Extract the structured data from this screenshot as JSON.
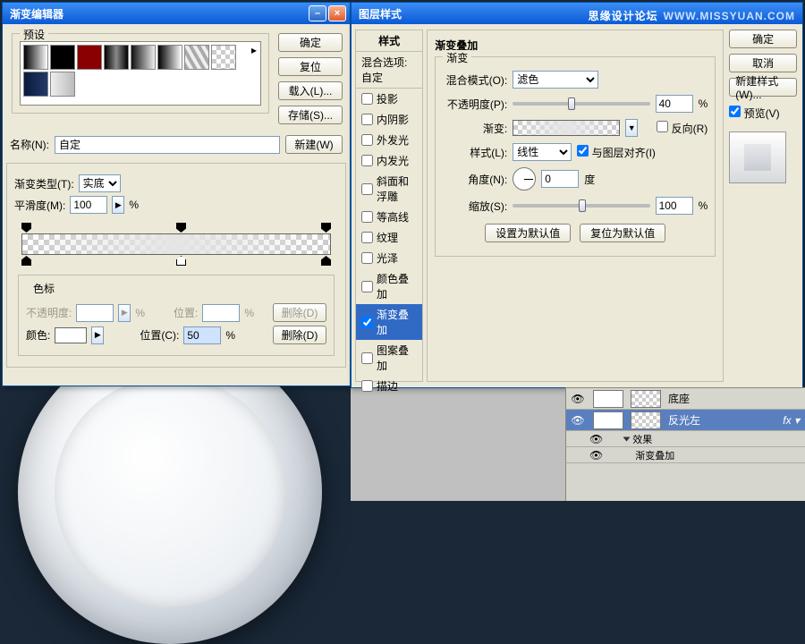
{
  "watermark": {
    "site": "思缘设计论坛",
    "url": "WWW.MISSYUAN.COM"
  },
  "ge": {
    "title": "渐变编辑器",
    "presets_label": "预设",
    "swatches": [
      "linear-gradient(90deg,#000,#fff)",
      "#000",
      "#8a0000",
      "linear-gradient(90deg,#000,#888,#000)",
      "linear-gradient(90deg,#111,#eee)",
      "linear-gradient(90deg,#000,#fff)",
      "repeating-linear-gradient(60deg,#aaa 0 4px,#eee 4px 8px)",
      "repeating-conic-gradient(#ccc 0 25%, #fff 0 50%) 0 0/10px 10px",
      "linear-gradient(90deg,#0a1a3a,#223a68)",
      "linear-gradient(90deg,#eee,#bbb)"
    ],
    "buttons": {
      "ok": "确定",
      "cancel": "复位",
      "load": "载入(L)...",
      "save": "存储(S)..."
    },
    "name_label": "名称(N):",
    "name_value": "自定",
    "new_btn": "新建(W)",
    "type_label": "渐变类型(T):",
    "type_value": "实底",
    "smooth_label": "平滑度(M):",
    "smooth_value": "100",
    "pct": "%",
    "stops_title": "色标",
    "opacity_label": "不透明度:",
    "opacity_value": "",
    "pos1_label": "位置:",
    "pos1_value": "",
    "del1": "删除(D)",
    "color_label": "颜色:",
    "pos2_label": "位置(C):",
    "pos2_value": "50",
    "del2": "删除(D)"
  },
  "ls": {
    "title": "图层样式",
    "list_header": "样式",
    "blend": "混合选项:自定",
    "items": [
      {
        "label": "投影",
        "checked": false
      },
      {
        "label": "内阴影",
        "checked": false
      },
      {
        "label": "外发光",
        "checked": false
      },
      {
        "label": "内发光",
        "checked": false
      },
      {
        "label": "斜面和浮雕",
        "checked": false
      },
      {
        "label": "等高线",
        "checked": false
      },
      {
        "label": "纹理",
        "checked": false
      },
      {
        "label": "光泽",
        "checked": false
      },
      {
        "label": "颜色叠加",
        "checked": false
      },
      {
        "label": "渐变叠加",
        "checked": true,
        "selected": true
      },
      {
        "label": "图案叠加",
        "checked": false
      },
      {
        "label": "描边",
        "checked": false
      }
    ],
    "panel_title": "渐变叠加",
    "sub_title": "渐变",
    "blendmode_label": "混合模式(O):",
    "blendmode_value": "滤色",
    "opacity_label": "不透明度(P):",
    "opacity_value": "40",
    "pct": "%",
    "grad_label": "渐变:",
    "reverse_label": "反向(R)",
    "style_label": "样式(L):",
    "style_value": "线性",
    "align_label": "与图层对齐(I)",
    "align_checked": true,
    "angle_label": "角度(N):",
    "angle_value": "0",
    "angle_unit": "度",
    "scale_label": "缩放(S):",
    "scale_value": "100",
    "default_set": "设置为默认值",
    "default_reset": "复位为默认值",
    "right": {
      "ok": "确定",
      "cancel": "取消",
      "newstyle": "新建样式(W)...",
      "preview_label": "预览(V)",
      "preview_checked": true
    }
  },
  "layers": {
    "items": [
      {
        "name": "底座",
        "selected": false
      },
      {
        "name": "反光左",
        "selected": true
      },
      {
        "name": "效果",
        "fx_header": true
      },
      {
        "name": "渐变叠加",
        "fx_item": true
      }
    ]
  }
}
